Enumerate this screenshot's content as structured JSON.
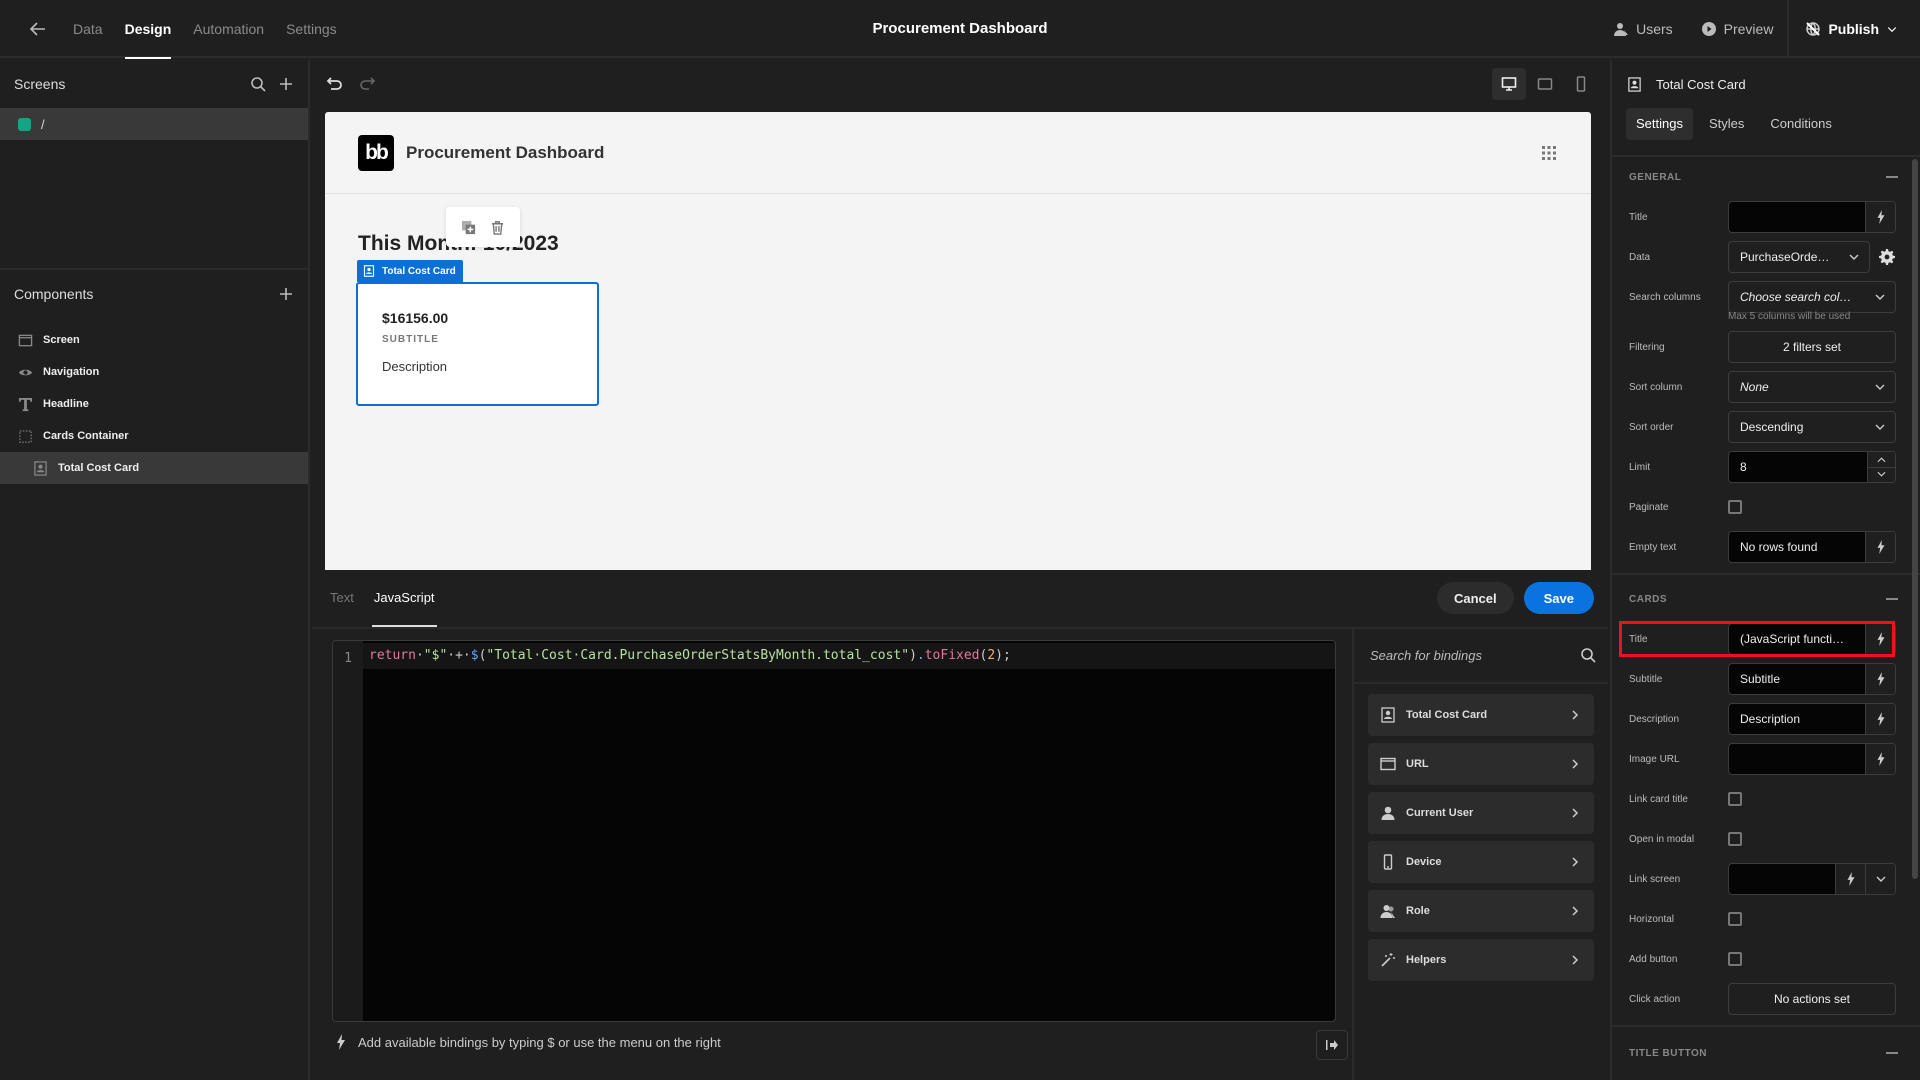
{
  "topbar": {
    "tabs": [
      "Data",
      "Design",
      "Automation",
      "Settings"
    ],
    "active_tab": "Design",
    "app_title": "Procurement Dashboard",
    "users_label": "Users",
    "preview_label": "Preview",
    "publish_label": "Publish"
  },
  "screens": {
    "heading": "Screens",
    "items": [
      {
        "route": "/",
        "color": "#15a585"
      }
    ]
  },
  "components": {
    "heading": "Components",
    "items": [
      {
        "label": "Screen",
        "icon": "screen-icon"
      },
      {
        "label": "Navigation",
        "icon": "eye-icon"
      },
      {
        "label": "Headline",
        "icon": "text-icon"
      },
      {
        "label": "Cards Container",
        "icon": "dashed-box-icon"
      },
      {
        "label": "Total Cost Card",
        "icon": "card-icon",
        "selected": true
      }
    ]
  },
  "preview": {
    "logo_text": "bb",
    "nav_title": "Procurement Dashboard",
    "headline": "This Month: 10/2023",
    "card_label": "Total Cost Card",
    "card": {
      "title": "$16156.00",
      "subtitle": "SUBTITLE",
      "description": "Description"
    }
  },
  "binding_editor": {
    "tabs": [
      "Text",
      "JavaScript"
    ],
    "active_tab": "JavaScript",
    "cancel_label": "Cancel",
    "save_label": "Save",
    "line_number": "1",
    "code": "return \"$\" + $(\"Total Cost Card.PurchaseOrderStatsByMonth.total_cost\").toFixed(2);",
    "code_tokens": {
      "kw": "return",
      "ws1": "·",
      "str1": "\"$\"",
      "ws2": "·+·",
      "dollar": "$",
      "p1": "(",
      "str2": "\"Total·Cost·Card.PurchaseOrderStatsByMonth.total_cost\"",
      "p2": ")",
      "dot": ".",
      "fn": "toFixed",
      "p3": "(",
      "num": "2",
      "p4": ");"
    },
    "hint": "Add available bindings by typing $ or use the menu on the right",
    "search_placeholder": "Search for bindings",
    "bindings": [
      {
        "label": "Total Cost Card",
        "icon": "card-icon"
      },
      {
        "label": "URL",
        "icon": "browser-icon"
      },
      {
        "label": "Current User",
        "icon": "user-icon"
      },
      {
        "label": "Device",
        "icon": "phone-icon"
      },
      {
        "label": "Role",
        "icon": "users-icon"
      },
      {
        "label": "Helpers",
        "icon": "magic-wand-icon"
      }
    ]
  },
  "settings_panel": {
    "component_name": "Total Cost Card",
    "tabs": [
      "Settings",
      "Styles",
      "Conditions"
    ],
    "active_tab": "Settings",
    "general": {
      "heading": "GENERAL",
      "title_label": "Title",
      "title_value": "",
      "data_label": "Data",
      "data_value": "PurchaseOrde…",
      "search_columns_label": "Search columns",
      "search_columns_placeholder": "Choose search col…",
      "search_hint": "Max 5 columns will be used",
      "filtering_label": "Filtering",
      "filtering_value": "2 filters set",
      "sort_column_label": "Sort column",
      "sort_column_value": "None",
      "sort_order_label": "Sort order",
      "sort_order_value": "Descending",
      "limit_label": "Limit",
      "limit_value": "8",
      "paginate_label": "Paginate",
      "paginate_checked": false,
      "empty_text_label": "Empty text",
      "empty_text_value": "No rows found"
    },
    "cards": {
      "heading": "CARDS",
      "title_label": "Title",
      "title_value": "(JavaScript functi…",
      "subtitle_label": "Subtitle",
      "subtitle_value": "Subtitle",
      "description_label": "Description",
      "description_value": "Description",
      "image_url_label": "Image URL",
      "image_url_value": "",
      "link_card_title_label": "Link card title",
      "link_card_title_checked": false,
      "open_in_modal_label": "Open in modal",
      "open_in_modal_checked": false,
      "link_screen_label": "Link screen",
      "link_screen_value": "",
      "horizontal_label": "Horizontal",
      "horizontal_checked": false,
      "add_button_label": "Add button",
      "add_button_checked": false,
      "click_action_label": "Click action",
      "click_action_value": "No actions set"
    },
    "title_button": {
      "heading": "TITLE BUTTON"
    }
  },
  "colors": {
    "accent": "#0a73e0",
    "selection": "#0a6fd6",
    "highlight": "#f0101e",
    "screen_swatch": "#15a585"
  }
}
